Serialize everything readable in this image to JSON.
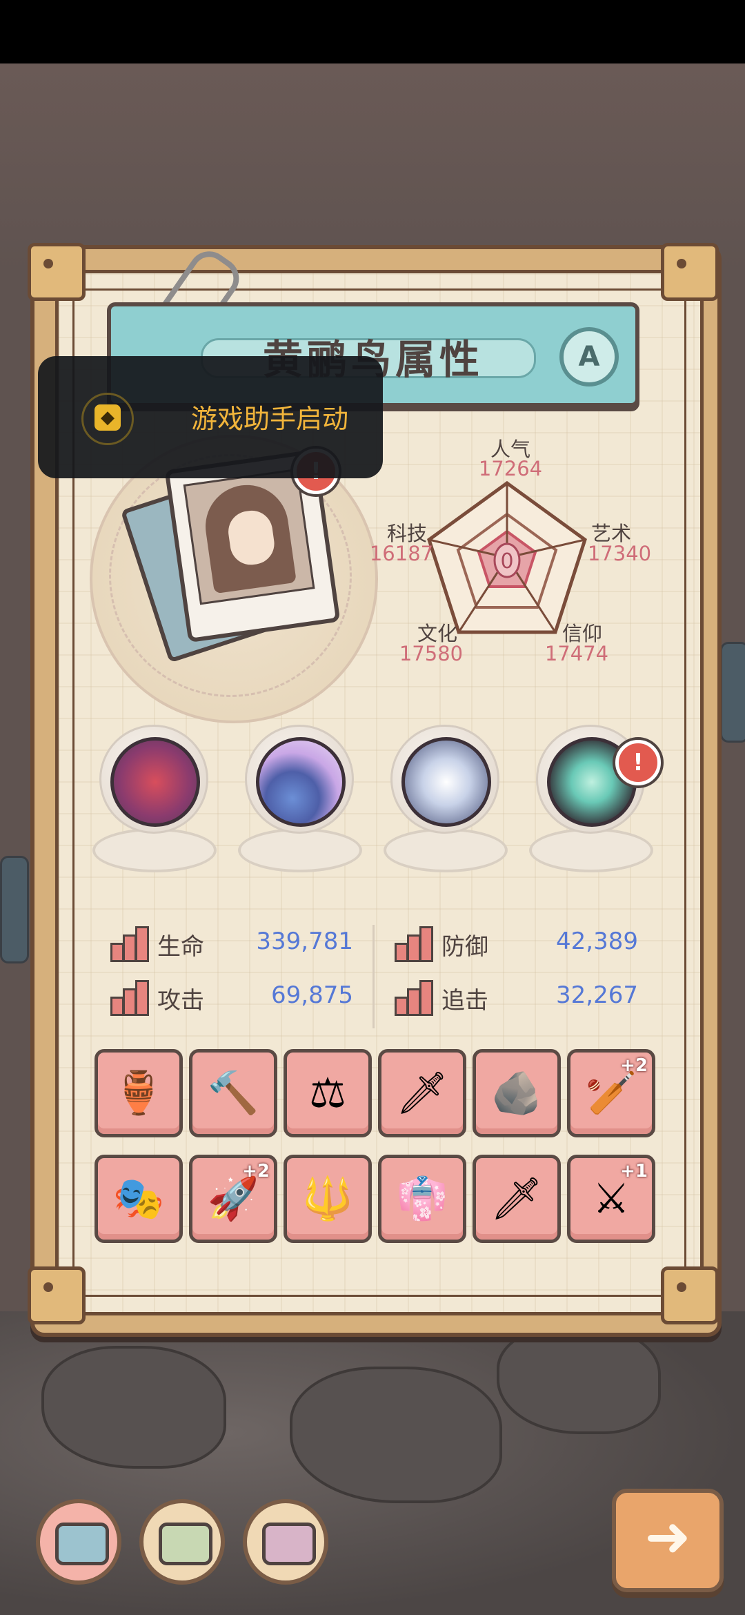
{
  "title": "黄鹂鸟属性",
  "grade": "A",
  "toast": {
    "text": "游戏助手启动",
    "icon": "cube-icon"
  },
  "portrait": {
    "alert": "!"
  },
  "radar": {
    "center_value": "0",
    "stats": [
      {
        "label": "人气",
        "value": "17264"
      },
      {
        "label": "艺术",
        "value": "17340"
      },
      {
        "label": "信仰",
        "value": "17474"
      },
      {
        "label": "文化",
        "value": "17580"
      },
      {
        "label": "科技",
        "value": "16187"
      }
    ]
  },
  "relics": [
    {
      "name": "tentacle-relic-icon"
    },
    {
      "name": "pearl-shell-relic-icon"
    },
    {
      "name": "compass-relic-icon"
    },
    {
      "name": "spiral-portal-relic-icon",
      "alert": "!"
    }
  ],
  "stats": [
    {
      "label": "生命",
      "value": "339,781",
      "icon": "health-bar-icon"
    },
    {
      "label": "防御",
      "value": "42,389",
      "icon": "shield-bar-icon"
    },
    {
      "label": "攻击",
      "value": "69,875",
      "icon": "sword-bar-icon"
    },
    {
      "label": "追击",
      "value": "32,267",
      "icon": "lightning-bar-icon"
    }
  ],
  "equipment": [
    {
      "icon": "golden-idol-icon",
      "glyph": "🏺",
      "plus": ""
    },
    {
      "icon": "hammer-icon",
      "glyph": "🔨",
      "plus": ""
    },
    {
      "icon": "slingshot-icon",
      "glyph": "⚖",
      "plus": ""
    },
    {
      "icon": "sword-icon",
      "glyph": "🗡",
      "plus": ""
    },
    {
      "icon": "rock-armor-icon",
      "glyph": "🪨",
      "plus": ""
    },
    {
      "icon": "spiked-mace-icon",
      "glyph": "🏏",
      "plus": "+2"
    },
    {
      "icon": "tribal-mask-staff-icon",
      "glyph": "🎭",
      "plus": ""
    },
    {
      "icon": "rocket-icon",
      "glyph": "🚀",
      "plus": "+2"
    },
    {
      "icon": "trident-icon",
      "glyph": "🔱",
      "plus": ""
    },
    {
      "icon": "robe-icon",
      "glyph": "👘",
      "plus": ""
    },
    {
      "icon": "spear-head-icon",
      "glyph": "🗡",
      "plus": ""
    },
    {
      "icon": "scythe-icon",
      "glyph": "⚔",
      "plus": "+1"
    }
  ],
  "bottom_buttons": [
    {
      "name": "blue-creature-button",
      "color": "#9cc3cf"
    },
    {
      "name": "green-creature-button",
      "color": "#c8d8b3"
    },
    {
      "name": "pink-creature-button",
      "color": "#d8b4c8"
    }
  ],
  "next_button": {
    "glyph": "➜"
  },
  "colors": {
    "accent_title": "#8fcfd0",
    "slot_bg": "#f0a8a2",
    "stat_value": "#5578d6",
    "radar_value": "#cf6d78"
  }
}
